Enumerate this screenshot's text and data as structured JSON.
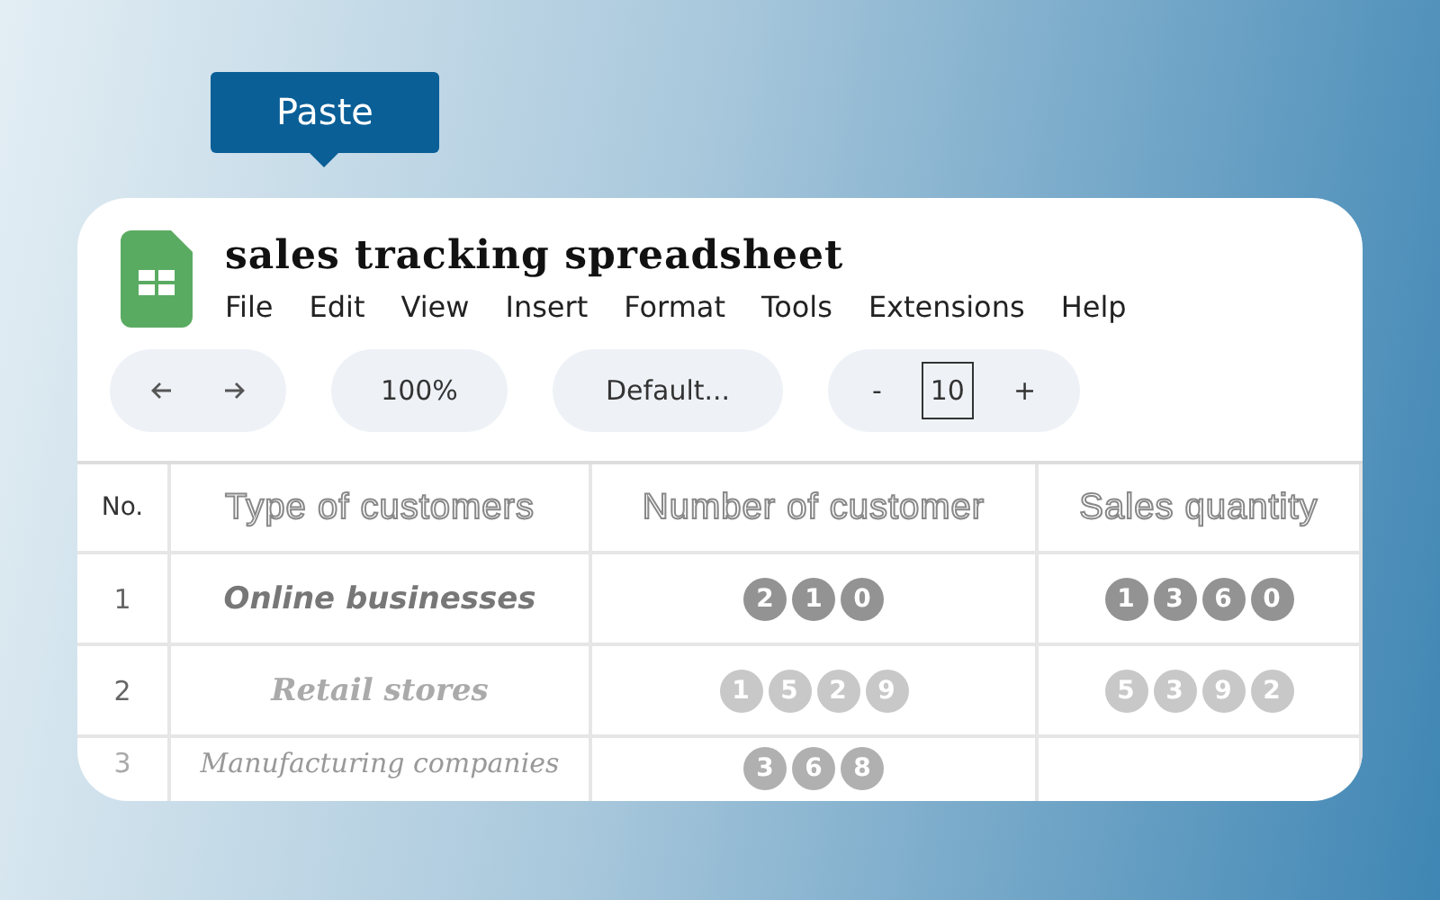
{
  "tooltip": {
    "label": "Paste"
  },
  "document": {
    "title": "sales tracking spreadsheet"
  },
  "menu": [
    "File",
    "Edit",
    "View",
    "Insert",
    "Format",
    "Tools",
    "Extensions",
    "Help"
  ],
  "toolbar": {
    "zoom": "100%",
    "font": "Default...",
    "decrease": "-",
    "font_size": "10",
    "increase": "+"
  },
  "table": {
    "columns": [
      "No.",
      "Type of customers",
      "Number of customer",
      "Sales quantity"
    ],
    "rows": [
      {
        "no": "1",
        "type": "Online businesses",
        "customers": [
          "2",
          "1",
          "0"
        ],
        "sales": [
          "1",
          "3",
          "6",
          "0"
        ]
      },
      {
        "no": "2",
        "type": "Retail stores",
        "customers": [
          "1",
          "5",
          "2",
          "9"
        ],
        "sales": [
          "5",
          "3",
          "9",
          "2"
        ]
      },
      {
        "no": "3",
        "type": "Manufacturing companies",
        "customers": [
          "3",
          "6",
          "8"
        ]
      }
    ]
  }
}
